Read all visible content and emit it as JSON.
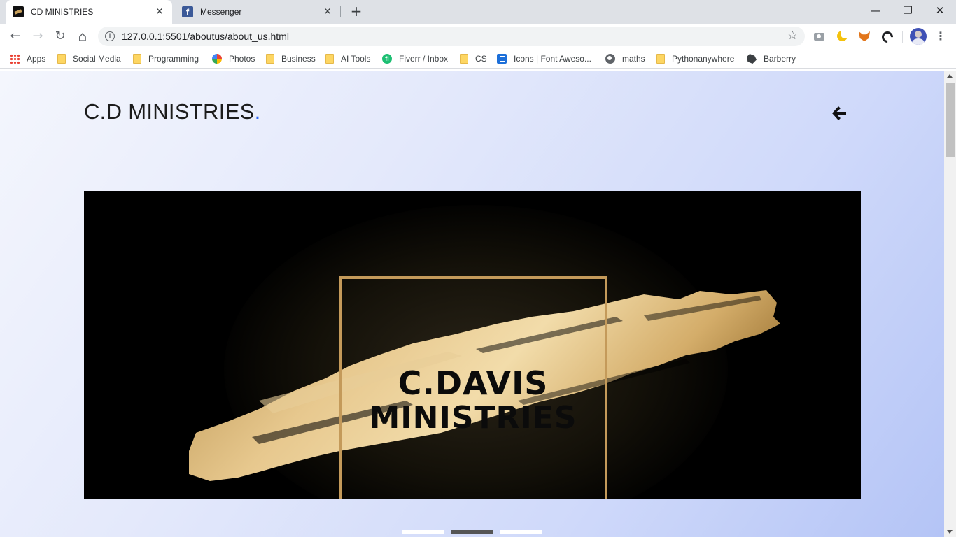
{
  "browser": {
    "tabs": [
      {
        "title": "CD MINISTRIES",
        "favicon": "cd-ministries-favicon",
        "active": true
      },
      {
        "title": "Messenger",
        "favicon": "facebook-favicon",
        "active": false
      }
    ],
    "new_tab": "+",
    "window_controls": {
      "minimize": "—",
      "restore": "❐",
      "close": "✕"
    },
    "toolbar": {
      "back": "←",
      "forward": "→",
      "reload": "↻",
      "home": "⌂",
      "info": "i",
      "url": "127.0.0.1:5501/aboutus/about_us.html",
      "bookmark_star": "☆",
      "menu": "⋮"
    },
    "bookmarks": [
      {
        "label": "Apps",
        "icon": "apps-grid-icon"
      },
      {
        "label": "Social Media",
        "icon": "folder-icon"
      },
      {
        "label": "Programming",
        "icon": "folder-icon"
      },
      {
        "label": "Photos",
        "icon": "google-photos-icon"
      },
      {
        "label": "Business",
        "icon": "folder-icon"
      },
      {
        "label": "AI Tools",
        "icon": "folder-icon"
      },
      {
        "label": "Fiverr / Inbox",
        "icon": "fiverr-icon"
      },
      {
        "label": "CS",
        "icon": "folder-icon"
      },
      {
        "label": "Icons | Font Aweso...",
        "icon": "font-awesome-icon"
      },
      {
        "label": "maths",
        "icon": "globe-icon"
      },
      {
        "label": "Pythonanywhere",
        "icon": "folder-icon"
      },
      {
        "label": "Barberry",
        "icon": "barberry-icon"
      }
    ]
  },
  "page": {
    "brand": {
      "text": "C.D MINISTRIES",
      "dot": ".",
      "dot_color": "#2f67f5"
    },
    "back_icon": "arrow-left-icon",
    "hero": {
      "logo_line1": "C.DAVIS",
      "logo_line2": "MINISTRIES",
      "background": "#000000",
      "gold_color": "#c49a5a"
    },
    "carousel": {
      "slides": 3,
      "active_index": 1
    }
  }
}
